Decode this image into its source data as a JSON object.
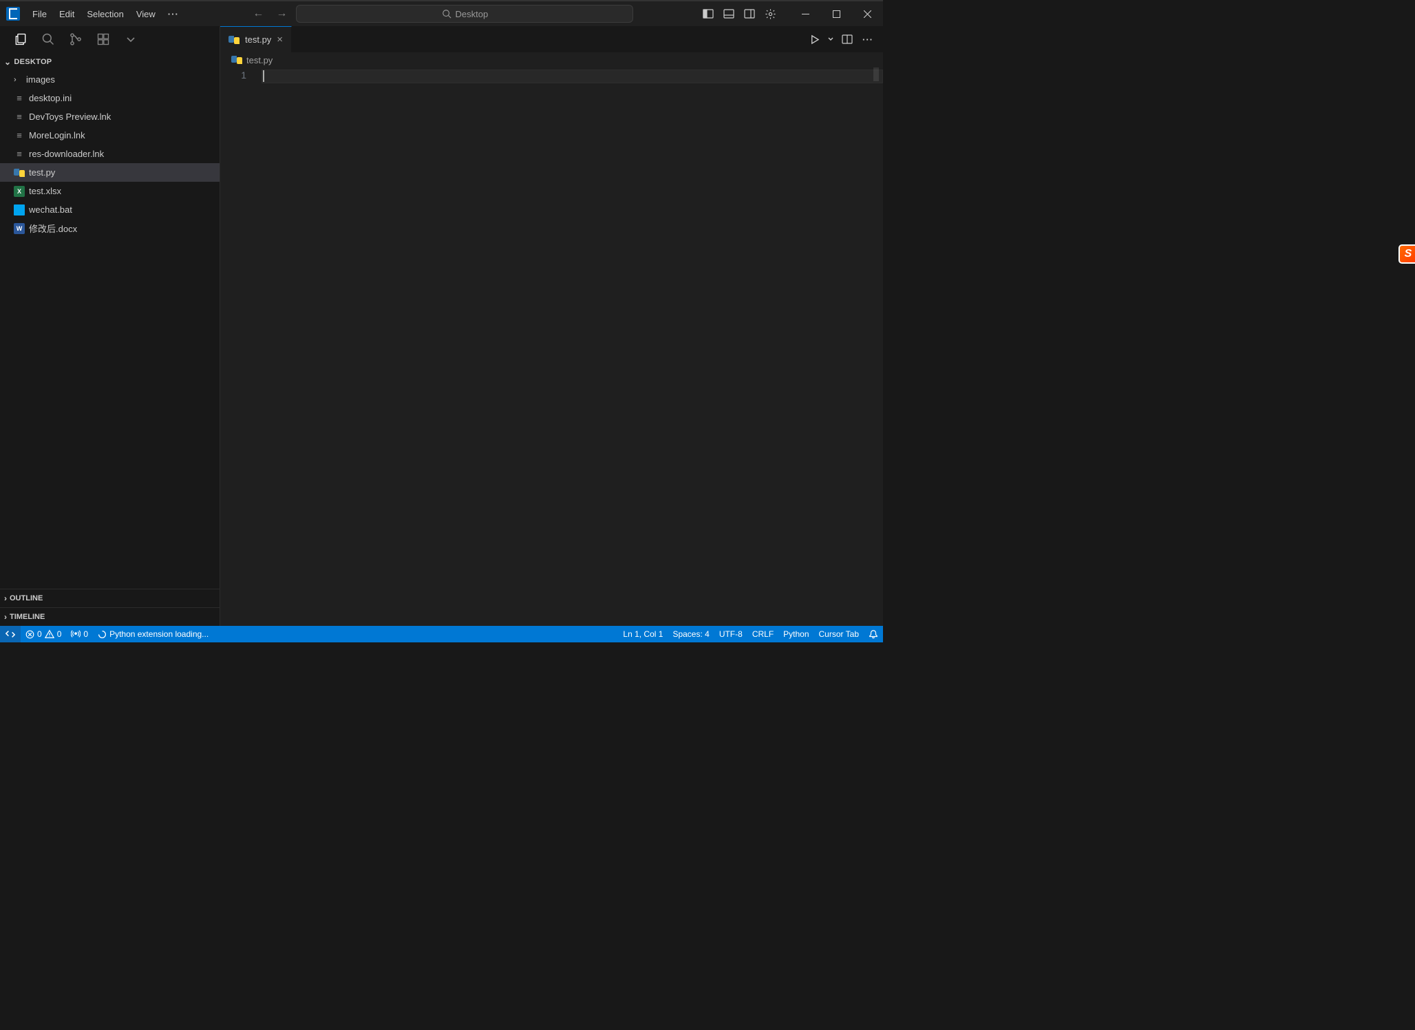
{
  "menubar": {
    "file": "File",
    "edit": "Edit",
    "selection": "Selection",
    "view": "View",
    "more": "···"
  },
  "search": {
    "placeholder": "Desktop"
  },
  "explorer": {
    "root": "DESKTOP",
    "items": [
      {
        "name": "images",
        "kind": "folder"
      },
      {
        "name": "desktop.ini",
        "kind": "ini"
      },
      {
        "name": "DevToys Preview.lnk",
        "kind": "lnk"
      },
      {
        "name": "MoreLogin.lnk",
        "kind": "lnk"
      },
      {
        "name": "res-downloader.lnk",
        "kind": "lnk"
      },
      {
        "name": "test.py",
        "kind": "py"
      },
      {
        "name": "test.xlsx",
        "kind": "xlsx"
      },
      {
        "name": "wechat.bat",
        "kind": "bat"
      },
      {
        "name": "修改后.docx",
        "kind": "docx"
      }
    ],
    "outline": "OUTLINE",
    "timeline": "TIMELINE"
  },
  "tabs": {
    "active": "test.py"
  },
  "breadcrumb": {
    "file": "test.py"
  },
  "editor": {
    "line1": "1"
  },
  "statusbar": {
    "errors": "0",
    "warnings": "0",
    "ports": "0",
    "loading": "Python extension loading...",
    "lncol": "Ln 1, Col 1",
    "spaces": "Spaces: 4",
    "encoding": "UTF-8",
    "eol": "CRLF",
    "lang": "Python",
    "cursor": "Cursor Tab"
  }
}
